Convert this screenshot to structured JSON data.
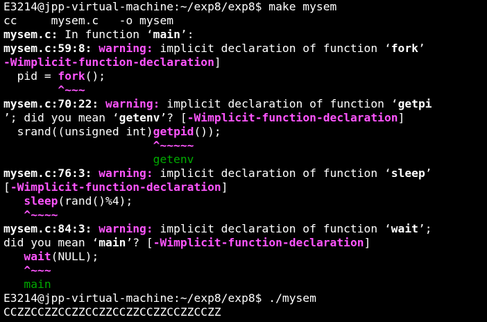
{
  "terminal": {
    "lines": [
      {
        "segments": [
          {
            "text": "E3214@jpp-virtual-machine:~/exp8/exp8$ make mysem",
            "style": "w"
          }
        ]
      },
      {
        "segments": [
          {
            "text": "cc     mysem.c   -o mysem",
            "style": "w"
          }
        ]
      },
      {
        "segments": [
          {
            "text": "mysem.c:",
            "style": "b"
          },
          {
            "text": " In function ",
            "style": "w"
          },
          {
            "text": "‘",
            "style": "w"
          },
          {
            "text": "main",
            "style": "b"
          },
          {
            "text": "’:",
            "style": "w"
          }
        ]
      },
      {
        "segments": [
          {
            "text": "mysem.c:59:8: ",
            "style": "b"
          },
          {
            "text": "warning:",
            "style": "m"
          },
          {
            "text": " implicit declaration of function ",
            "style": "w"
          },
          {
            "text": "‘",
            "style": "w"
          },
          {
            "text": "fork",
            "style": "b"
          },
          {
            "text": "’",
            "style": "w"
          }
        ]
      },
      {
        "segments": [
          {
            "text": "-Wimplicit-function-declaration",
            "style": "m"
          },
          {
            "text": "]",
            "style": "w"
          }
        ]
      },
      {
        "segments": [
          {
            "text": "  pid = ",
            "style": "w"
          },
          {
            "text": "fork",
            "style": "m"
          },
          {
            "text": "();",
            "style": "w"
          }
        ]
      },
      {
        "segments": [
          {
            "text": "        ^~~~",
            "style": "m"
          }
        ]
      },
      {
        "segments": [
          {
            "text": "mysem.c:70:22: ",
            "style": "b"
          },
          {
            "text": "warning:",
            "style": "m"
          },
          {
            "text": " implicit declaration of function ",
            "style": "w"
          },
          {
            "text": "‘",
            "style": "w"
          },
          {
            "text": "getpi",
            "style": "b"
          }
        ]
      },
      {
        "segments": [
          {
            "text": "’; did you mean ",
            "style": "w"
          },
          {
            "text": "‘",
            "style": "w"
          },
          {
            "text": "getenv",
            "style": "b"
          },
          {
            "text": "’? [",
            "style": "w"
          },
          {
            "text": "-Wimplicit-function-declaration",
            "style": "m"
          },
          {
            "text": "]",
            "style": "w"
          }
        ]
      },
      {
        "segments": [
          {
            "text": "  srand((unsigned int)",
            "style": "w"
          },
          {
            "text": "getpid",
            "style": "m"
          },
          {
            "text": "());",
            "style": "w"
          }
        ]
      },
      {
        "segments": [
          {
            "text": "                      ^~~~~~",
            "style": "m"
          }
        ]
      },
      {
        "segments": [
          {
            "text": "                      getenv",
            "style": "g"
          }
        ]
      },
      {
        "segments": [
          {
            "text": "mysem.c:76:3: ",
            "style": "b"
          },
          {
            "text": "warning:",
            "style": "m"
          },
          {
            "text": " implicit declaration of function ",
            "style": "w"
          },
          {
            "text": "‘",
            "style": "w"
          },
          {
            "text": "sleep",
            "style": "b"
          },
          {
            "text": "’",
            "style": "w"
          }
        ]
      },
      {
        "segments": [
          {
            "text": "[",
            "style": "w"
          },
          {
            "text": "-Wimplicit-function-declaration",
            "style": "m"
          },
          {
            "text": "]",
            "style": "w"
          }
        ]
      },
      {
        "segments": [
          {
            "text": "   ",
            "style": "w"
          },
          {
            "text": "sleep",
            "style": "m"
          },
          {
            "text": "(rand()%4);",
            "style": "w"
          }
        ]
      },
      {
        "segments": [
          {
            "text": "   ^~~~~",
            "style": "m"
          }
        ]
      },
      {
        "segments": [
          {
            "text": "mysem.c:84:3: ",
            "style": "b"
          },
          {
            "text": "warning:",
            "style": "m"
          },
          {
            "text": " implicit declaration of function ",
            "style": "w"
          },
          {
            "text": "‘",
            "style": "w"
          },
          {
            "text": "wait",
            "style": "b"
          },
          {
            "text": "’;",
            "style": "w"
          }
        ]
      },
      {
        "segments": [
          {
            "text": "did you mean ",
            "style": "w"
          },
          {
            "text": "‘",
            "style": "w"
          },
          {
            "text": "main",
            "style": "b"
          },
          {
            "text": "’? [",
            "style": "w"
          },
          {
            "text": "-Wimplicit-function-declaration",
            "style": "m"
          },
          {
            "text": "]",
            "style": "w"
          }
        ]
      },
      {
        "segments": [
          {
            "text": "   ",
            "style": "w"
          },
          {
            "text": "wait",
            "style": "m"
          },
          {
            "text": "(NULL);",
            "style": "w"
          }
        ]
      },
      {
        "segments": [
          {
            "text": "   ^~~~",
            "style": "m"
          }
        ]
      },
      {
        "segments": [
          {
            "text": "   main",
            "style": "g"
          }
        ]
      },
      {
        "segments": [
          {
            "text": "E3214@jpp-virtual-machine:~/exp8/exp8$ ./mysem",
            "style": "w"
          }
        ]
      },
      {
        "segments": [
          {
            "text": "CCZZCCZZCCZZCCZZCCZZCCZZCCZZCCZZ",
            "style": "w"
          }
        ]
      }
    ]
  },
  "colors": {
    "background": "#000000",
    "foreground": "#ffffff",
    "warning_magenta": "#ff55ff",
    "suggestion_green": "#00aa00"
  }
}
